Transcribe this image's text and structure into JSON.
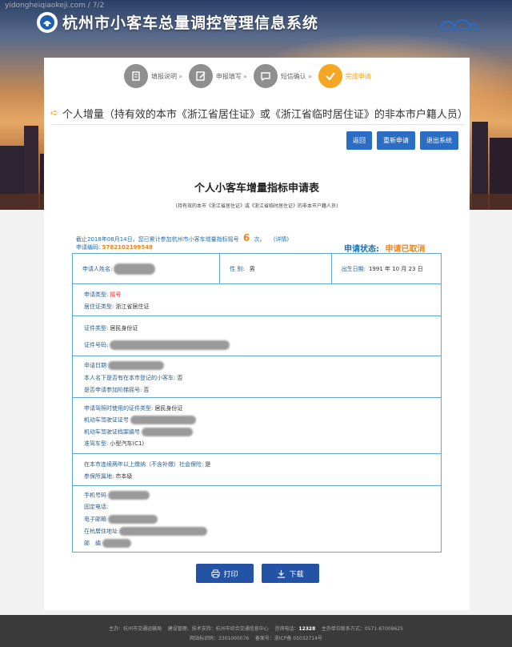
{
  "watermark": "yidongheiqiaokeji.com / 7/2",
  "header": {
    "title": "杭州市小客车总量调控管理信息系统"
  },
  "steps": [
    {
      "label": "填报说明",
      "icon": "document-icon",
      "done": false
    },
    {
      "label": "申报填写",
      "icon": "edit-icon",
      "done": false
    },
    {
      "label": "短信确认",
      "icon": "message-icon",
      "done": false
    },
    {
      "label": "完成申请",
      "icon": "check-icon",
      "done": true
    }
  ],
  "section": {
    "heading": "个人增量（持有效的本市《浙江省居住证》或《浙江省临时居住证》的非本市户籍人员）"
  },
  "toolbar": {
    "back": "返回",
    "reapply": "重新申请",
    "logout": "退出系统"
  },
  "form": {
    "title": "个人小客车增量指标申请表",
    "subtitle": "(持有效的本市《浙江省居住证》或《浙江省临时居住证》的非本市户籍人员)",
    "notice_prefix": "截止2018年08月14日，您已累计参加杭州市小客车增量指标摇号",
    "notice_count": "6",
    "notice_suffix": "次。",
    "notice_detail": "(详情)",
    "app_no_label": "申请编码:",
    "app_no_value": "5782102199548",
    "status_label": "申请状态:",
    "status_value": "申请已取消"
  },
  "table": {
    "name_label": "申请人姓名:",
    "gender_label": "性 别:",
    "gender_value": "男",
    "birth_label": "出生日期:",
    "birth_value": "1991 年 10 月 23 日",
    "apply_type_label": "申请类型:",
    "apply_type_value": "摇号",
    "residence_type_label": "居住证类型:",
    "residence_type_value": "浙江省居住证",
    "id_type_label": "证件类型:",
    "id_type_value": "居民身份证",
    "id_no_label": "证件号码:",
    "apply_date_label": "申请日期",
    "has_car_label": "本人名下是否有在本市登记的小客车:",
    "has_car_value": "否",
    "tiered_label": "是否申请参加阶梯摇号:",
    "tiered_value": "否",
    "license_id_type_label": "申请驾照时使用的证件类型:",
    "license_id_type_value": "居民身份证",
    "license_no_label": "机动车驾驶证证号",
    "license_file_label": "机动车驾驶证档案编号",
    "license_class_label": "准驾车型:",
    "license_class_value": "小型汽车(C1)",
    "insurance_label": "在本市连续两年以上缴纳（不含补缴）社会保险:",
    "insurance_value": "是",
    "insured_place_label": "参保所属地:",
    "insured_place_value": "市本级",
    "phone_label": "手机号码",
    "landline_label": "固定电话:",
    "email_label": "电子邮箱",
    "address_label": "在杭居住地址",
    "postcode_label": "邮　编"
  },
  "actions": {
    "print": "打印",
    "download": "下载"
  },
  "footer": {
    "host": "主办：杭州市交通运输局",
    "builder": "建设管理、技术支持：杭州市综合交通信息中心",
    "hotline_label": "咨询电话：",
    "hotline_value": "12328",
    "contact": "主办单位联系方式：0571-87008625",
    "site_id": "网站标识码：3301000076",
    "icp": "备案号：浙ICP备 05032714号"
  },
  "colors": {
    "accent": "#f5a623",
    "primary": "#2b6cc4",
    "link": "#1a6fb5",
    "warn": "#f0841d"
  }
}
